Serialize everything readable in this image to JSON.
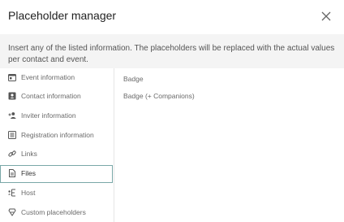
{
  "dialog": {
    "title": "Placeholder manager",
    "description": "Insert any of the listed information. The placeholders will be replaced with the actual values per contact and event."
  },
  "sidebar": {
    "items": [
      {
        "label": "Event information",
        "icon": "calendar-icon"
      },
      {
        "label": "Contact information",
        "icon": "contact-card-icon"
      },
      {
        "label": "Inviter information",
        "icon": "person-plus-icon"
      },
      {
        "label": "Registration information",
        "icon": "form-list-icon"
      },
      {
        "label": "Links",
        "icon": "link-icon"
      },
      {
        "label": "Files",
        "icon": "file-icon",
        "active": true
      },
      {
        "label": "Host",
        "icon": "host-icon"
      },
      {
        "label": "Custom placeholders",
        "icon": "custom-placeholder-icon"
      }
    ]
  },
  "placeholders": {
    "items": [
      "Badge",
      "Badge (+ Companions)"
    ]
  },
  "colors": {
    "active_border": "#7aa8a8",
    "description_bg": "#f4f4f4"
  }
}
